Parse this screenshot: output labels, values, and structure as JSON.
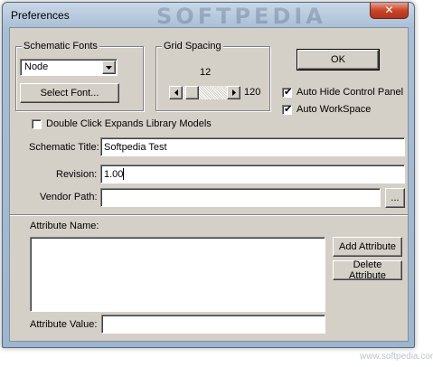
{
  "window": {
    "title": "Preferences",
    "watermark": "SOFTPEDIA",
    "close_glyph": "✕"
  },
  "schematic_fonts": {
    "group_label": "Schematic Fonts",
    "selected": "Node",
    "select_font_label": "Select Font..."
  },
  "grid_spacing": {
    "group_label": "Grid Spacing",
    "value": "12",
    "max": "120",
    "fraction": 0.1
  },
  "ok_label": "OK",
  "options": {
    "auto_hide": {
      "label": "Auto Hide Control Panel",
      "checked": true
    },
    "auto_workspace": {
      "label": "Auto WorkSpace",
      "checked": true
    },
    "double_click": {
      "label": "Double Click Expands Library Models",
      "checked": false
    }
  },
  "fields": {
    "schematic_title": {
      "label": "Schematic Title:",
      "value": "Softpedia Test"
    },
    "revision": {
      "label": "Revision:",
      "value": "1.00"
    },
    "vendor_path": {
      "label": "Vendor Path:",
      "value": "",
      "browse_label": "..."
    }
  },
  "attributes": {
    "name_label": "Attribute Name:",
    "value_label": "Attribute Value:",
    "value": "",
    "add_label": "Add Attribute",
    "delete_label": "Delete Attribute"
  },
  "footer_watermark": "www.softpedia.com"
}
